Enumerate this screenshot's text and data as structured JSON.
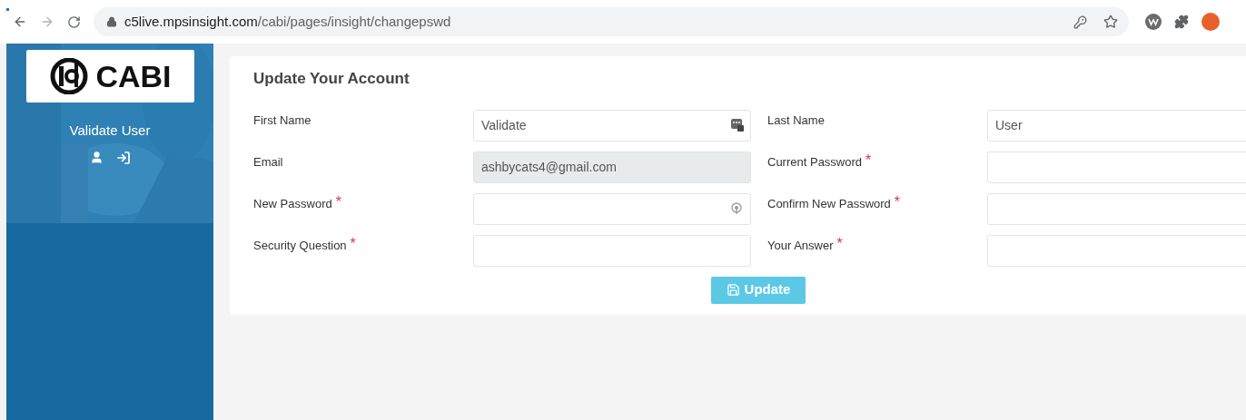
{
  "browser": {
    "url_host": "c5live.mpsinsight.com",
    "url_path": "/cabi/pages/insight/changepswd"
  },
  "sidebar": {
    "logo_text": "CABI",
    "user_name": "Validate User"
  },
  "form": {
    "title": "Update Your Account",
    "fields": [
      {
        "label": "First Name",
        "required": false,
        "value": "Validate",
        "disabled": false,
        "kind": "contact"
      },
      {
        "label": "Last Name",
        "required": false,
        "value": "User",
        "disabled": false,
        "kind": "text"
      },
      {
        "label": "Email",
        "required": false,
        "value": "ashbycats4@gmail.com",
        "disabled": true,
        "kind": "text"
      },
      {
        "label": "Current Password",
        "required": true,
        "disabled": false,
        "kind": "text"
      },
      {
        "label": "New Password",
        "required": true,
        "disabled": false,
        "kind": "password"
      },
      {
        "label": "Confirm New Password",
        "required": true,
        "disabled": false,
        "kind": "text"
      },
      {
        "label": "Security Question",
        "required": true,
        "disabled": false,
        "kind": "text"
      },
      {
        "label": "Your Answer",
        "required": true,
        "disabled": false,
        "kind": "text"
      }
    ],
    "required_mark": "*",
    "submit": "Update"
  }
}
